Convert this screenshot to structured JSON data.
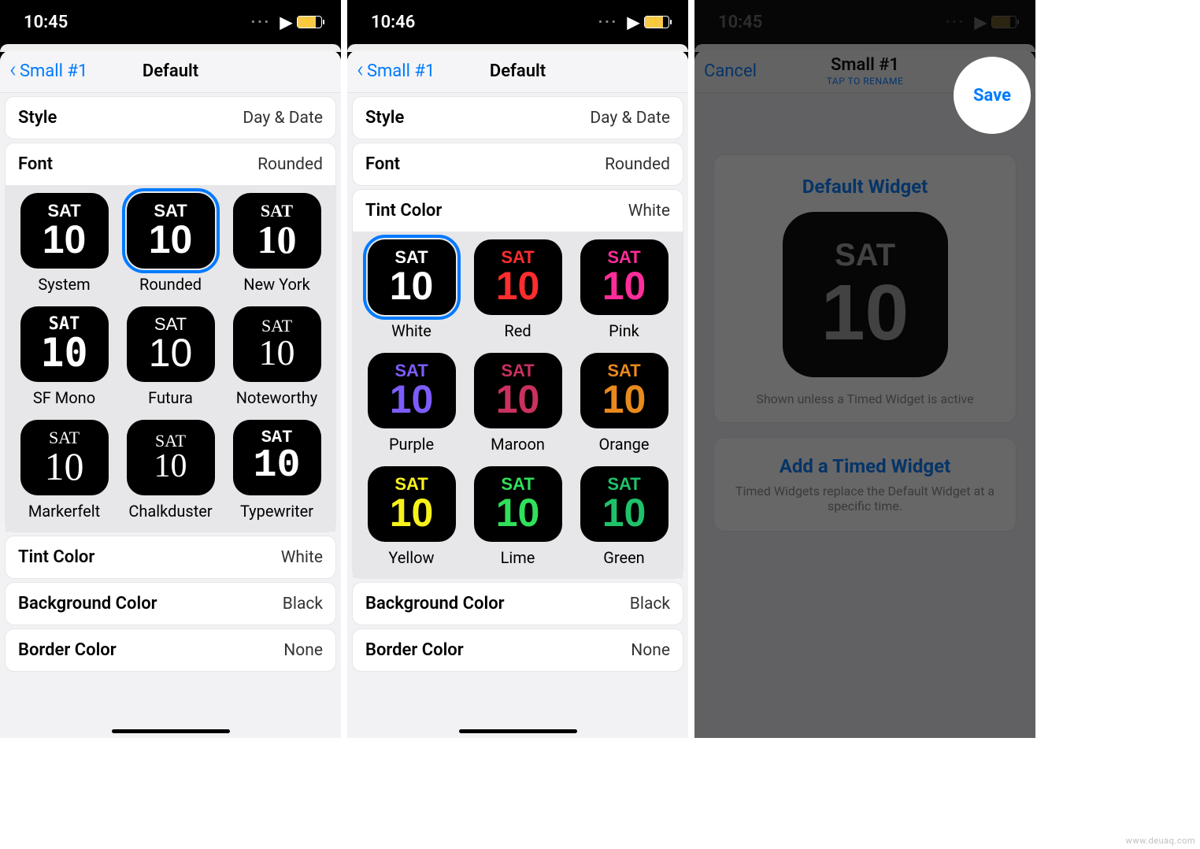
{
  "phones": [
    {
      "time": "10:45",
      "back": "Small #1",
      "title": "Default",
      "rows": {
        "style": {
          "label": "Style",
          "value": "Day & Date"
        },
        "font": {
          "label": "Font",
          "value": "Rounded"
        },
        "tint": {
          "label": "Tint Color",
          "value": "White"
        },
        "bg": {
          "label": "Background Color",
          "value": "Black"
        },
        "border": {
          "label": "Border Color",
          "value": "None"
        }
      },
      "fontGrid": [
        {
          "label": "System",
          "cls": "f-system"
        },
        {
          "label": "Rounded",
          "cls": "f-rounded",
          "selected": true
        },
        {
          "label": "New York",
          "cls": "f-newyork"
        },
        {
          "label": "SF Mono",
          "cls": "f-sfmono"
        },
        {
          "label": "Futura",
          "cls": "f-futura"
        },
        {
          "label": "Noteworthy",
          "cls": "f-noteworthy"
        },
        {
          "label": "Markerfelt",
          "cls": "f-marker"
        },
        {
          "label": "Chalkduster",
          "cls": "f-chalk"
        },
        {
          "label": "Typewriter",
          "cls": "f-type"
        }
      ],
      "sample": {
        "day": "SAT",
        "num": "10"
      }
    },
    {
      "time": "10:46",
      "back": "Small #1",
      "title": "Default",
      "rows": {
        "style": {
          "label": "Style",
          "value": "Day & Date"
        },
        "font": {
          "label": "Font",
          "value": "Rounded"
        },
        "tint": {
          "label": "Tint Color",
          "value": "White"
        },
        "bg": {
          "label": "Background Color",
          "value": "Black"
        },
        "border": {
          "label": "Border Color",
          "value": "None"
        }
      },
      "colorGrid": [
        {
          "label": "White",
          "cls": "c-white",
          "selected": true
        },
        {
          "label": "Red",
          "cls": "c-red"
        },
        {
          "label": "Pink",
          "cls": "c-pink"
        },
        {
          "label": "Purple",
          "cls": "c-purple"
        },
        {
          "label": "Maroon",
          "cls": "c-maroon"
        },
        {
          "label": "Orange",
          "cls": "c-orange"
        },
        {
          "label": "Yellow",
          "cls": "c-yellow"
        },
        {
          "label": "Lime",
          "cls": "c-lime"
        },
        {
          "label": "Green",
          "cls": "c-green"
        }
      ],
      "sample": {
        "day": "SAT",
        "num": "10"
      }
    },
    {
      "time": "10:45",
      "cancel": "Cancel",
      "title": "Small #1",
      "subtitle": "TAP TO RENAME",
      "save": "Save",
      "preview": {
        "title": "Default Widget",
        "day": "SAT",
        "num": "10",
        "caption": "Shown unless a Timed Widget is active"
      },
      "timed": {
        "title": "Add a Timed Widget",
        "caption": "Timed Widgets replace the Default Widget at a specific time."
      }
    }
  ],
  "watermark": "www.deuaq.com"
}
